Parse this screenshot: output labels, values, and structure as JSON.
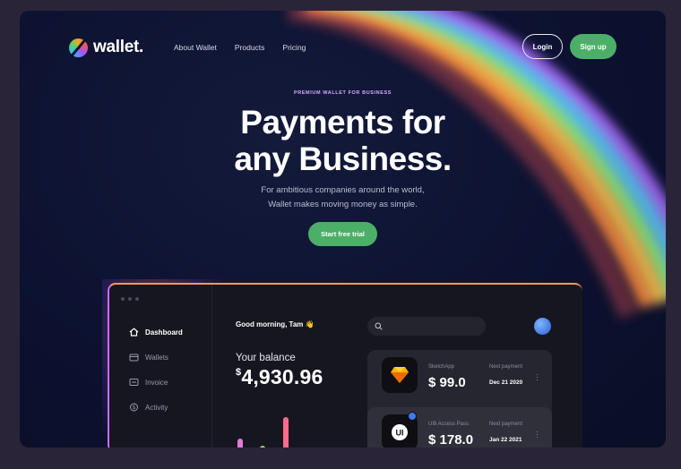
{
  "brand": {
    "name": "wallet."
  },
  "nav": {
    "links": [
      "About Wallet",
      "Products",
      "Pricing"
    ],
    "login": "Login",
    "signup": "Sign up"
  },
  "hero": {
    "eyebrow": "PREMIUM WALLET FOR BUSINESS",
    "title_line1": "Payments for",
    "title_line2": "any Business.",
    "sub_line1": "For ambitious companies around the world,",
    "sub_line2": "Wallet makes moving money as simple.",
    "cta": "Start free trial"
  },
  "app": {
    "sidebar": [
      {
        "label": "Dashboard",
        "icon": "home-icon",
        "active": true
      },
      {
        "label": "Wallets",
        "icon": "wallet-icon",
        "active": false
      },
      {
        "label": "Invoice",
        "icon": "invoice-icon",
        "active": false
      },
      {
        "label": "Activity",
        "icon": "activity-icon",
        "active": false
      }
    ],
    "greeting": "Good morning, Tam 👋",
    "balance_label": "Your balance",
    "balance_currency": "$",
    "balance_value": "4,930.96",
    "payments": [
      {
        "name": "SketchApp",
        "amount": "$ 99.0",
        "next_label": "Next payment",
        "date": "Dec 21 2020",
        "icon": "sketch-icon"
      },
      {
        "name": "UI8 Access Pass",
        "amount": "$ 178.0",
        "next_label": "Next payment",
        "date": "Jan 22 2021",
        "icon": "ui8-icon"
      }
    ]
  },
  "colors": {
    "background": "#0c1130",
    "accent_green": "#4caf68",
    "eyebrow": "#d9a9ff",
    "app_panel": "#161620"
  }
}
